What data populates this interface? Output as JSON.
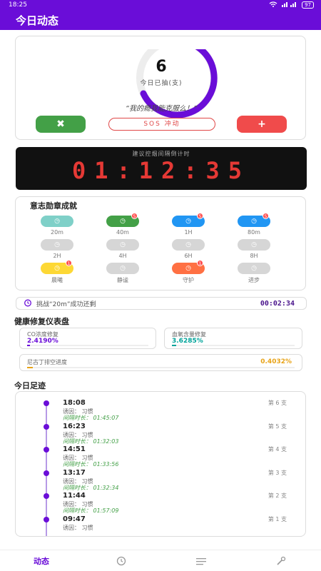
{
  "status_bar": {
    "time": "18:25",
    "battery": "97"
  },
  "app_bar": {
    "title": "今日动态"
  },
  "counter": {
    "count": "6",
    "label": "今日已抽(支)",
    "quote": "“我的瘾我能克服么！”",
    "sos_label": "SOS 冲动",
    "x_label": "✖",
    "plus_label": "+",
    "ring_color": "#6a0dd8"
  },
  "timer": {
    "label": "建议控烟间隔倒计时",
    "value": "01:12:35"
  },
  "medals": {
    "title": "意志勋章成就",
    "items": [
      {
        "label": "20m",
        "color": "#7fd0c8",
        "badge": ""
      },
      {
        "label": "40m",
        "color": "#43a047",
        "badge": "5"
      },
      {
        "label": "1H",
        "color": "#2196f3",
        "badge": "5"
      },
      {
        "label": "80m",
        "color": "#2196f3",
        "badge": "5"
      },
      {
        "label": "2H",
        "color": "#d6d6d6",
        "badge": ""
      },
      {
        "label": "4H",
        "color": "#d6d6d6",
        "badge": ""
      },
      {
        "label": "6H",
        "color": "#d6d6d6",
        "badge": ""
      },
      {
        "label": "8H",
        "color": "#d6d6d6",
        "badge": ""
      },
      {
        "label": "晨曦",
        "color": "#fdd835",
        "badge": "1"
      },
      {
        "label": "静谧",
        "color": "#d6d6d6",
        "badge": ""
      },
      {
        "label": "守护",
        "color": "#ff7043",
        "badge": "1"
      },
      {
        "label": "进步",
        "color": "#d6d6d6",
        "badge": ""
      }
    ]
  },
  "challenge": {
    "text": "挑战“20m”成功还剩",
    "value": "00:02:34"
  },
  "health": {
    "title": "健康修复仪表盘",
    "co": {
      "label": "CO浓度修复",
      "value": "2.4190%",
      "fraction": 0.024
    },
    "oxygen": {
      "label": "血氧含量修复",
      "value": "3.6285%",
      "fraction": 0.036
    },
    "nicotine": {
      "label": "尼古丁排空进度",
      "value": "0.4032%",
      "fraction": 0.004
    }
  },
  "footprints": {
    "title": "今日足迹",
    "items": [
      {
        "time": "18:08",
        "cause": "诱因： 习惯",
        "interval": "间隔时长： 01:45:07",
        "nth": "第 6 支"
      },
      {
        "time": "16:23",
        "cause": "诱因： 习惯",
        "interval": "间隔时长： 01:32:03",
        "nth": "第 5 支"
      },
      {
        "time": "14:51",
        "cause": "诱因： 习惯",
        "interval": "间隔时长： 01:33:56",
        "nth": "第 4 支"
      },
      {
        "time": "13:17",
        "cause": "诱因： 习惯",
        "interval": "间隔时长： 01:32:34",
        "nth": "第 3 支"
      },
      {
        "time": "11:44",
        "cause": "诱因： 习惯",
        "interval": "间隔时长： 01:57:09",
        "nth": "第 2 支"
      },
      {
        "time": "09:47",
        "cause": "诱因： 习惯",
        "interval": "",
        "nth": "第 1 支"
      }
    ]
  },
  "nav": {
    "home_label": "动态"
  }
}
